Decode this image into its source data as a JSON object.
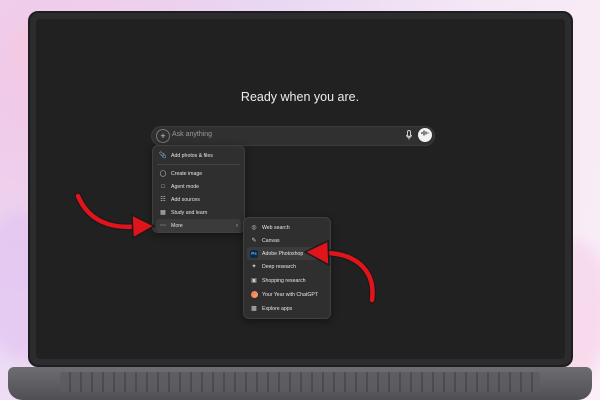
{
  "main": {
    "headline": "Ready when you are."
  },
  "composer": {
    "placeholder": "Ask anything"
  },
  "attach_menu": {
    "items": [
      {
        "label": "Add photos & files",
        "icon": "paperclip-icon"
      },
      {
        "label": "Create image",
        "icon": "image-icon"
      },
      {
        "label": "Agent mode",
        "icon": "agent-icon"
      },
      {
        "label": "Add sources",
        "icon": "sources-icon"
      },
      {
        "label": "Study and learn",
        "icon": "book-icon"
      },
      {
        "label": "More",
        "icon": "ellipsis-icon"
      }
    ]
  },
  "more_menu": {
    "items": [
      {
        "label": "Web search",
        "icon": "globe-icon"
      },
      {
        "label": "Canvas",
        "icon": "canvas-icon"
      },
      {
        "label": "Adobe Photoshop",
        "icon": "photoshop-icon"
      },
      {
        "label": "Deep research",
        "icon": "telescope-icon"
      },
      {
        "label": "Shopping research",
        "icon": "bag-icon"
      },
      {
        "label": "Your Year with ChatGPT",
        "icon": "year-icon"
      },
      {
        "label": "Explore apps",
        "icon": "apps-icon"
      }
    ],
    "photoshop_badge": "Ps"
  },
  "colors": {
    "annotation_arrow": "#e0141b",
    "background": "#212121"
  }
}
